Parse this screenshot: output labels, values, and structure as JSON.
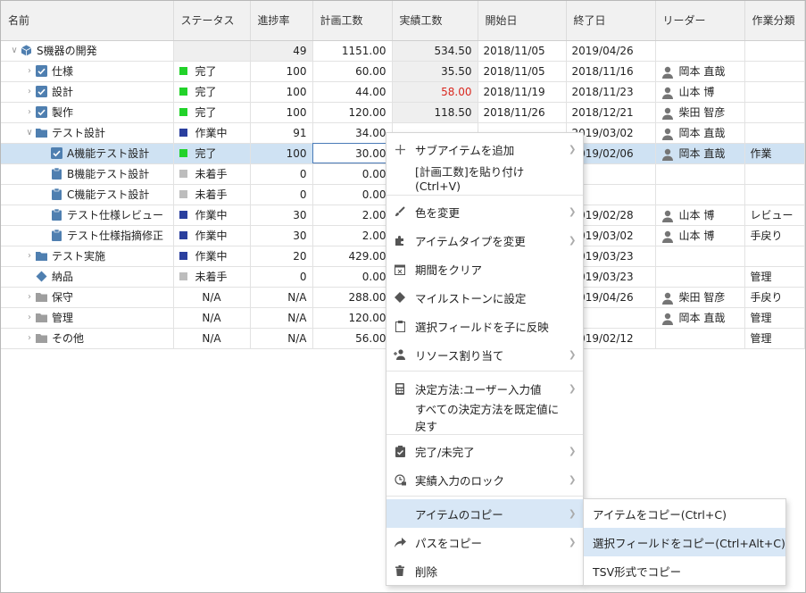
{
  "columns": [
    "名前",
    "ステータス",
    "進捗率",
    "計画工数",
    "実績工数",
    "開始日",
    "終了日",
    "リーダー",
    "作業分類"
  ],
  "rows": [
    {
      "name": "S機器の開発",
      "status": "",
      "progress": "49",
      "plan": "1151.00",
      "actual": "534.50",
      "start": "2018/11/05",
      "end": "2019/04/26",
      "leader": "",
      "category": ""
    },
    {
      "name": "仕様",
      "status": "完了",
      "progress": "100",
      "plan": "60.00",
      "actual": "35.50",
      "start": "2018/11/05",
      "end": "2018/11/16",
      "leader": "岡本 直哉",
      "category": ""
    },
    {
      "name": "設計",
      "status": "完了",
      "progress": "100",
      "plan": "44.00",
      "actual": "58.00",
      "start": "2018/11/19",
      "end": "2018/11/23",
      "leader": "山本 博",
      "category": ""
    },
    {
      "name": "製作",
      "status": "完了",
      "progress": "100",
      "plan": "120.00",
      "actual": "118.50",
      "start": "2018/11/26",
      "end": "2018/12/21",
      "leader": "柴田 智彦",
      "category": ""
    },
    {
      "name": "テスト設計",
      "status": "作業中",
      "progress": "91",
      "plan": "34.00",
      "actual": "",
      "start": "",
      "end": "2019/03/02",
      "leader": "岡本 直哉",
      "category": ""
    },
    {
      "name": "A機能テスト設計",
      "status": "完了",
      "progress": "100",
      "plan": "30.00",
      "actual": "",
      "start": "",
      "end": "2019/02/06",
      "leader": "岡本 直哉",
      "category": "作業"
    },
    {
      "name": "B機能テスト設計",
      "status": "未着手",
      "progress": "0",
      "plan": "0.00",
      "actual": "",
      "start": "",
      "end": "",
      "leader": "",
      "category": ""
    },
    {
      "name": "C機能テスト設計",
      "status": "未着手",
      "progress": "0",
      "plan": "0.00",
      "actual": "",
      "start": "",
      "end": "",
      "leader": "",
      "category": ""
    },
    {
      "name": "テスト仕様レビュー",
      "status": "作業中",
      "progress": "30",
      "plan": "2.00",
      "actual": "",
      "start": "",
      "end": "2019/02/28",
      "leader": "山本 博",
      "category": "レビュー"
    },
    {
      "name": "テスト仕様指摘修正",
      "status": "作業中",
      "progress": "30",
      "plan": "2.00",
      "actual": "",
      "start": "",
      "end": "2019/03/02",
      "leader": "山本 博",
      "category": "手戻り"
    },
    {
      "name": "テスト実施",
      "status": "作業中",
      "progress": "20",
      "plan": "429.00",
      "actual": "",
      "start": "",
      "end": "2019/03/23",
      "leader": "",
      "category": ""
    },
    {
      "name": "納品",
      "status": "未着手",
      "progress": "0",
      "plan": "0.00",
      "actual": "",
      "start": "",
      "end": "2019/03/23",
      "leader": "",
      "category": "管理"
    },
    {
      "name": "保守",
      "status": "N/A",
      "progress": "N/A",
      "plan": "288.00",
      "actual": "",
      "start": "",
      "end": "2019/04/26",
      "leader": "柴田 智彦",
      "category": "手戻り"
    },
    {
      "name": "管理",
      "status": "N/A",
      "progress": "N/A",
      "plan": "120.00",
      "actual": "",
      "start": "",
      "end": "",
      "leader": "岡本 直哉",
      "category": "管理"
    },
    {
      "name": "その他",
      "status": "N/A",
      "progress": "N/A",
      "plan": "56.00",
      "actual": "",
      "start": "",
      "end": "2019/02/12",
      "leader": "",
      "category": "管理"
    }
  ],
  "context_menu": {
    "add_subitem": "サブアイテムを追加",
    "paste_plan": "[計画工数]を貼り付け(Ctrl+V)",
    "change_color": "色を変更",
    "change_type": "アイテムタイプを変更",
    "clear_period": "期間をクリア",
    "set_milestone": "マイルストーンに設定",
    "reflect_fields": "選択フィールドを子に反映",
    "assign_resource": "リソース割り当て",
    "decision_method": "決定方法:ユーザー入力値",
    "reset_methods": "すべての決定方法を既定値に戻す",
    "complete_toggle": "完了/未完了",
    "lock_actual": "実績入力のロック",
    "copy_item": "アイテムのコピー",
    "copy_path": "パスをコピー",
    "delete": "削除"
  },
  "copy_submenu": {
    "copy_item": "アイテムをコピー(Ctrl+C)",
    "copy_selected_fields": "選択フィールドをコピー(Ctrl+Alt+C)",
    "copy_tsv": "TSV形式でコピー"
  },
  "colors": {
    "done": "#22d22a",
    "in_progress": "#2a3f9e",
    "not_started": "#bdbdbd",
    "selection": "#cfe2f3",
    "folder": "#4f7fb0",
    "over_actual": "#d9281f"
  }
}
